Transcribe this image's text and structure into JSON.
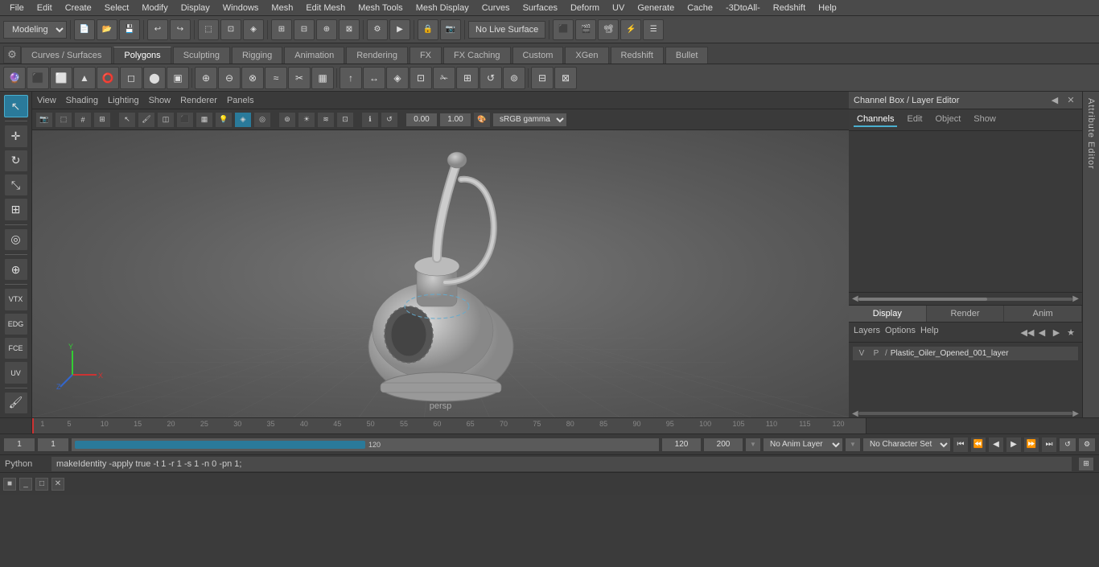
{
  "menubar": {
    "items": [
      "File",
      "Edit",
      "Create",
      "Select",
      "Modify",
      "Display",
      "Windows",
      "Mesh",
      "Edit Mesh",
      "Mesh Tools",
      "Mesh Display",
      "Curves",
      "Surfaces",
      "Deform",
      "UV",
      "Generate",
      "Cache",
      "-3DtoAll-",
      "Redshift",
      "Help"
    ]
  },
  "toolbar1": {
    "workspace_dropdown": "Modeling",
    "live_surface": "No Live Surface"
  },
  "tabs": {
    "items": [
      "Curves / Surfaces",
      "Polygons",
      "Sculpting",
      "Rigging",
      "Animation",
      "Rendering",
      "FX",
      "FX Caching",
      "Custom",
      "XGen",
      "Redshift",
      "Bullet"
    ],
    "active": "Polygons"
  },
  "viewport": {
    "menus": [
      "View",
      "Shading",
      "Lighting",
      "Show",
      "Renderer",
      "Panels"
    ],
    "persp_label": "persp",
    "camera_val1": "0.00",
    "camera_val2": "1.00",
    "color_space": "sRGB gamma"
  },
  "channel_box": {
    "title": "Channel Box / Layer Editor",
    "tabs": [
      "Channels",
      "Edit",
      "Object",
      "Show"
    ],
    "active_tab": "Channels"
  },
  "layer_editor": {
    "tabs": [
      "Display",
      "Render",
      "Anim"
    ],
    "active_tab": "Display",
    "options": [
      "Layers",
      "Options",
      "Help"
    ],
    "layer": {
      "v": "V",
      "p": "P",
      "name": "Plastic_Oiler_Opened_001_layer"
    }
  },
  "timeline": {
    "start": "1",
    "end": "120",
    "current": "1",
    "range_start": "1",
    "range_end": "120",
    "max_end": "200",
    "tick_labels": [
      "1",
      "5",
      "10",
      "15",
      "20",
      "25",
      "30",
      "35",
      "40",
      "45",
      "50",
      "55",
      "60",
      "65",
      "70",
      "75",
      "80",
      "85",
      "90",
      "95",
      "100",
      "105",
      "110",
      "115",
      "120"
    ]
  },
  "playback": {
    "frame_current": "1",
    "frame_start": "1",
    "frame_end": "120",
    "frame_range_end": "200",
    "anim_layer": "No Anim Layer",
    "char_set": "No Character Set",
    "buttons": [
      "⏮",
      "◀◀",
      "◀",
      "▶",
      "▶▶",
      "⏭",
      "⏹"
    ]
  },
  "status_bar": {
    "mode": "Python",
    "command": "makeIdentity -apply true -t 1 -r 1 -s 1 -n 0 -pn 1;"
  },
  "window": {
    "icon": "■",
    "minimize": "_",
    "maximize": "□",
    "close": "✕"
  },
  "axis": {
    "x_label": "X",
    "y_label": "Y",
    "z_label": "Z"
  }
}
